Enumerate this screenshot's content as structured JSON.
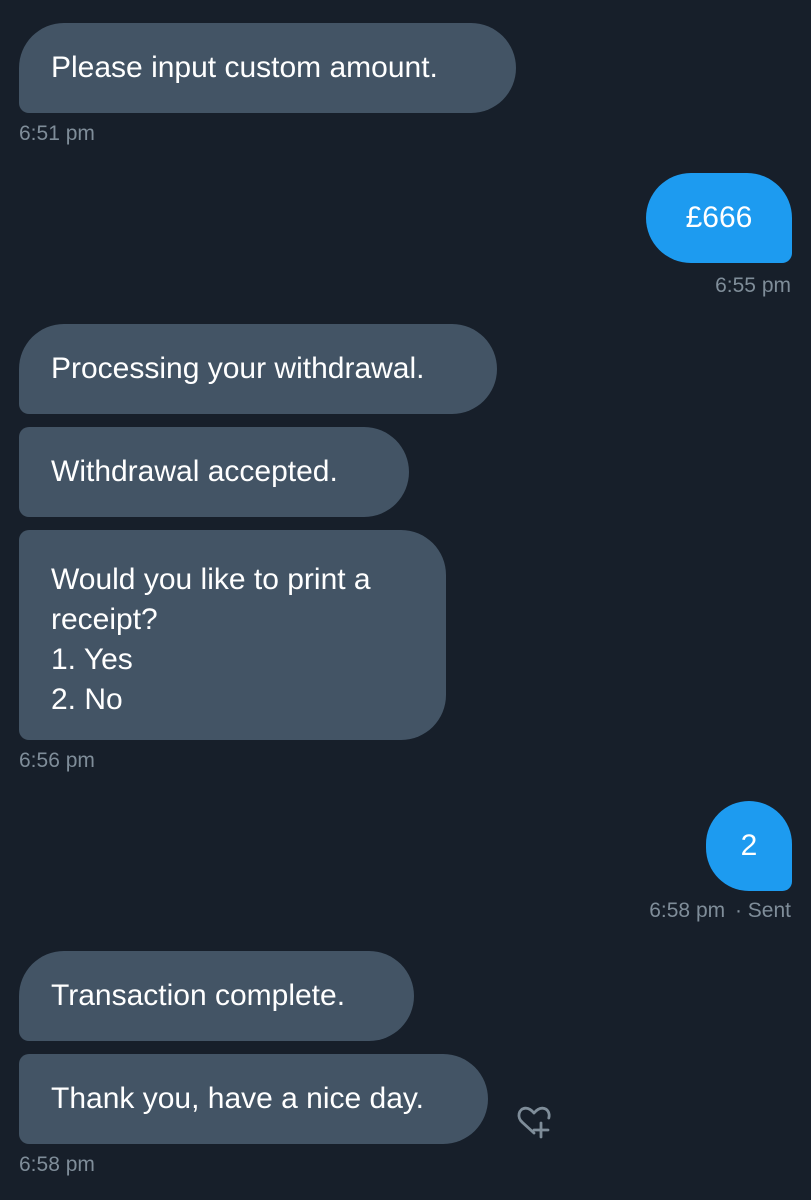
{
  "messages": [
    {
      "direction": "received",
      "text": "Please input custom amount."
    },
    {
      "direction": "sent",
      "text": "£666"
    },
    {
      "direction": "received",
      "text": "Processing your withdrawal."
    },
    {
      "direction": "received",
      "text": "Withdrawal accepted."
    },
    {
      "direction": "received",
      "text": "Would you like to print a\nreceipt?\n1. Yes\n2. No"
    },
    {
      "direction": "sent",
      "text": "2"
    },
    {
      "direction": "received",
      "text": "Transaction complete."
    },
    {
      "direction": "received",
      "text": "Thank you, have a nice day."
    }
  ],
  "timestamps": {
    "t1": "6:51 pm",
    "t2": "6:55 pm",
    "t3": "6:56 pm",
    "t4": "6:58 pm",
    "t4_status": "· Sent",
    "t5": "6:58 pm"
  },
  "icons": {
    "add_reaction": "heart-plus-icon"
  },
  "colors": {
    "background": "#171f2a",
    "received_bubble": "#435465",
    "sent_bubble": "#1d9bf0",
    "timestamp": "#7f8d99"
  }
}
